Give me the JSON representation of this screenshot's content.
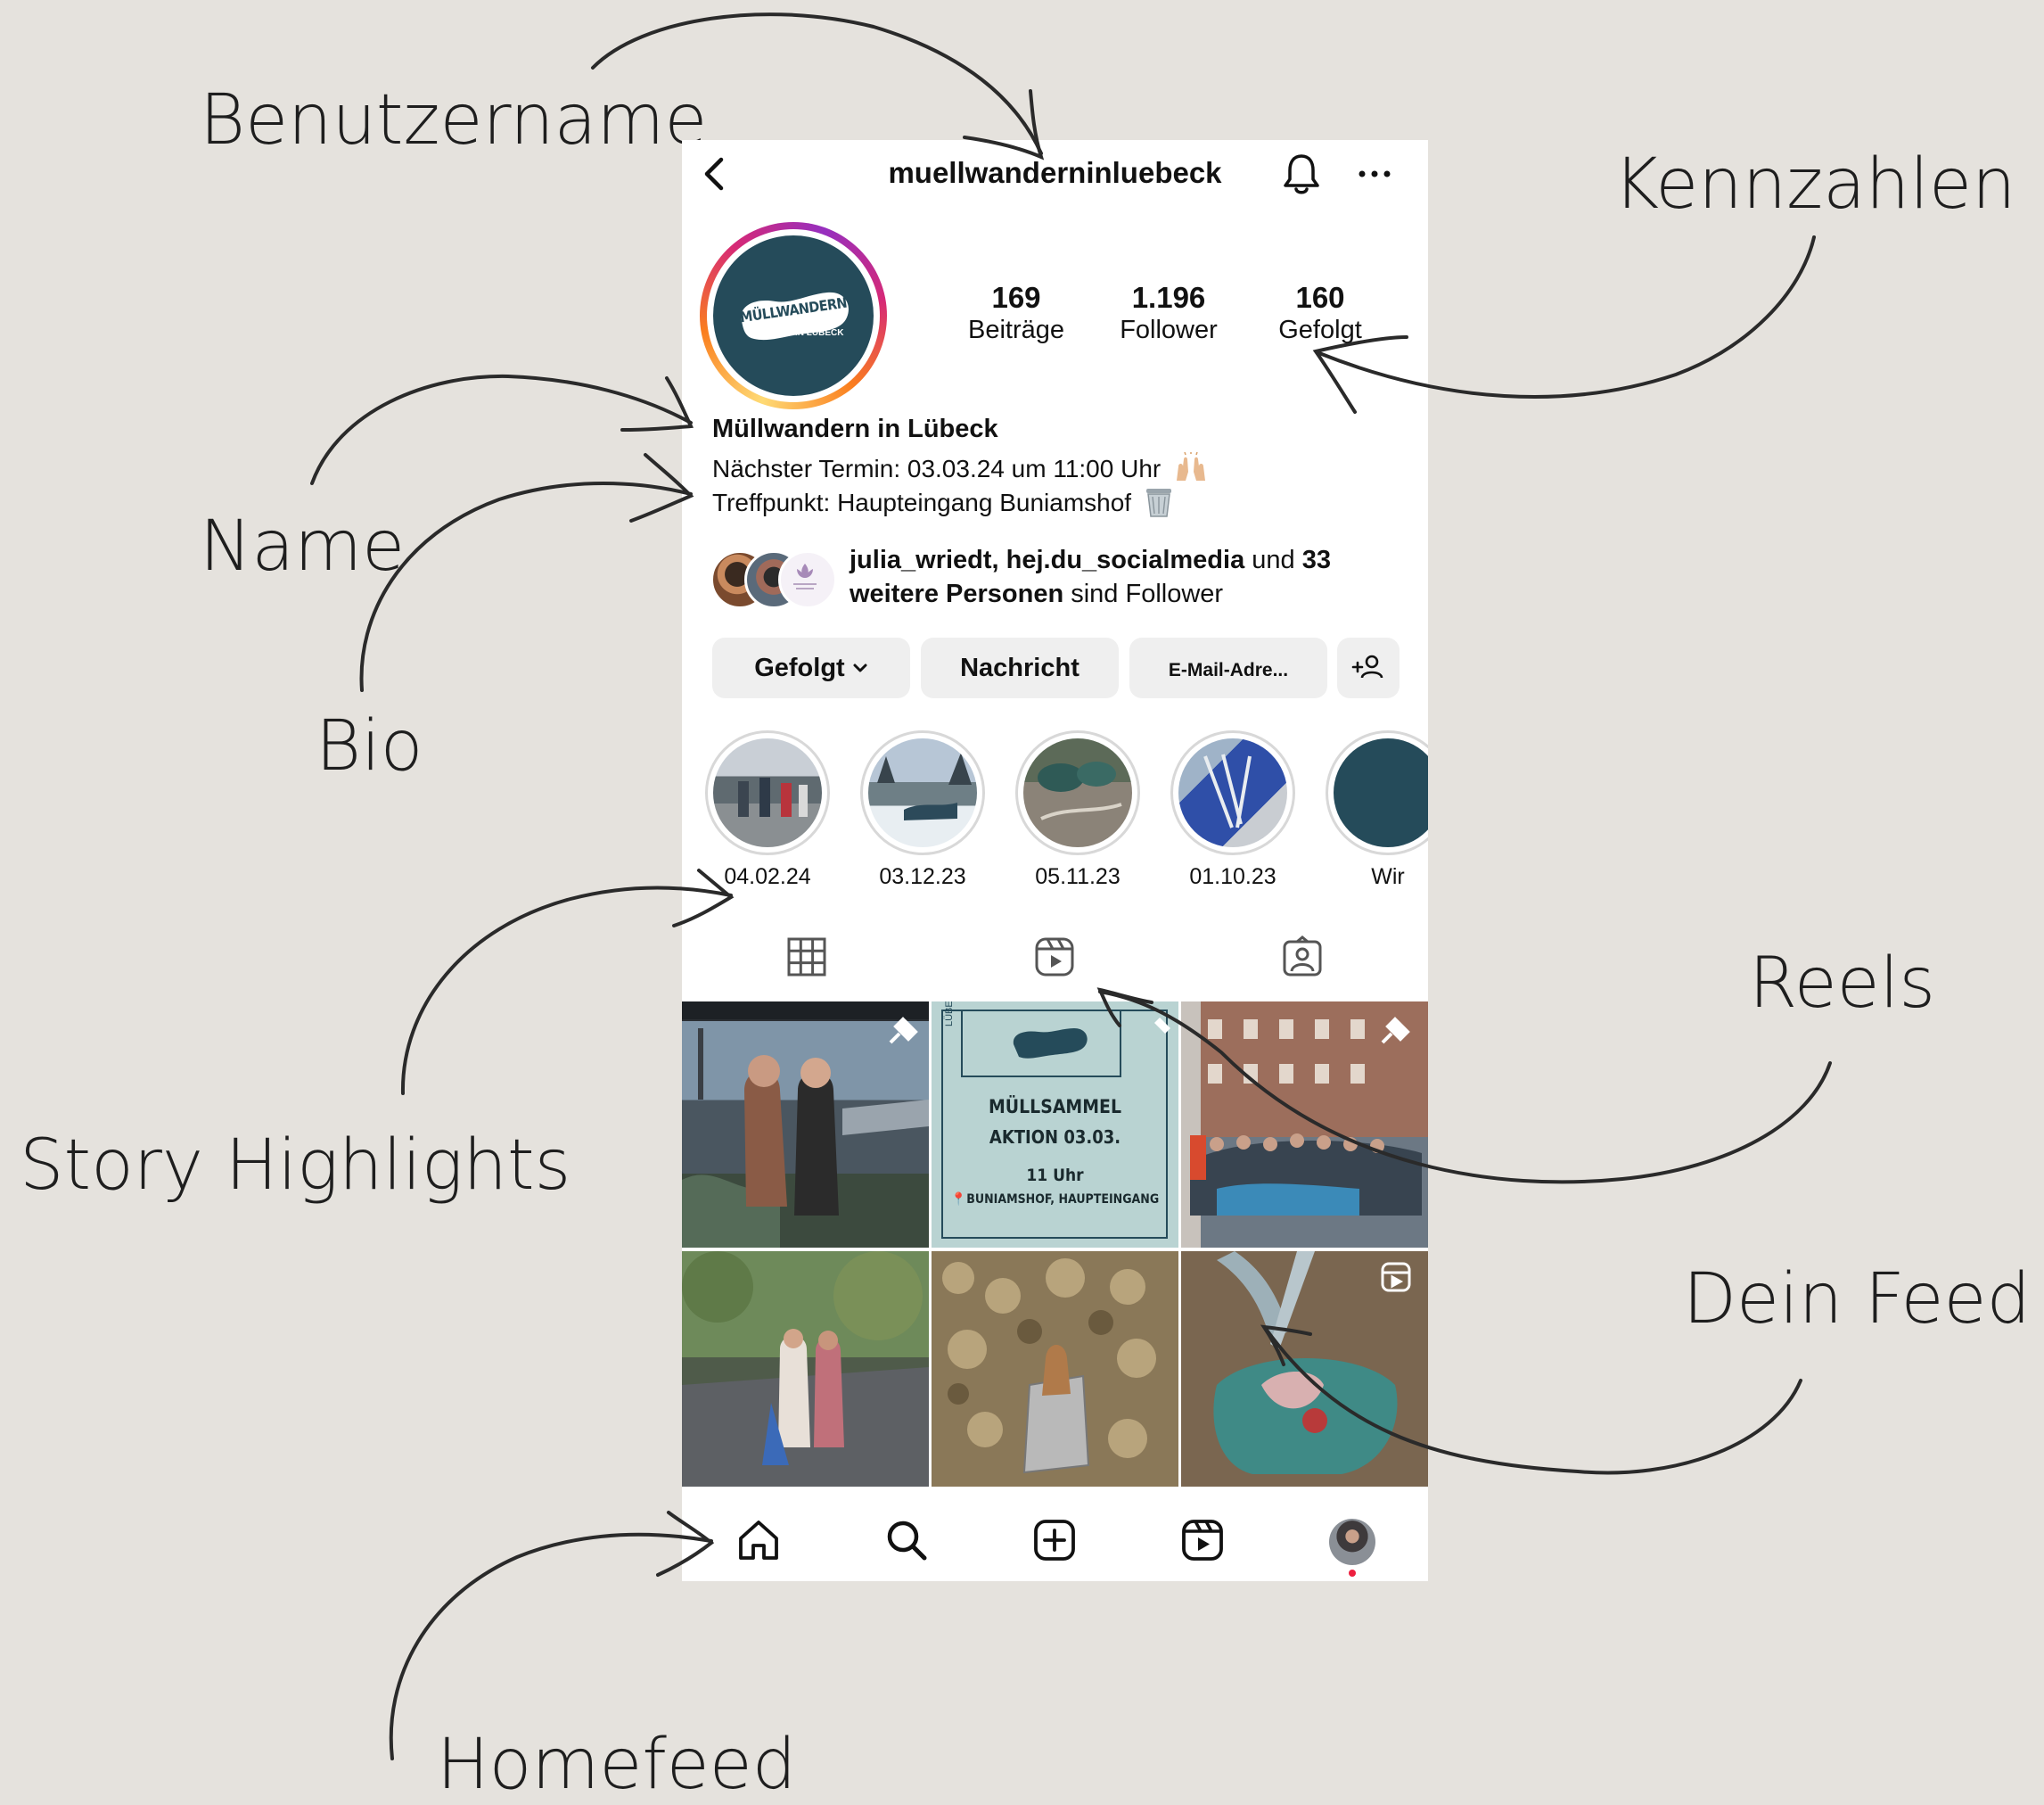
{
  "annotations": {
    "benutzername": "Benutzername",
    "kennzahlen": "Kennzahlen",
    "name": "Name",
    "bio": "Bio",
    "story_highlights": "Story Highlights",
    "reels": "Reels",
    "dein_feed": "Dein Feed",
    "homefeed": "Homefeed"
  },
  "profile": {
    "username": "muellwanderninluebeck",
    "logo_text": "MÜLLWANDERN",
    "logo_sub": "IN LÜBECK",
    "stats": [
      {
        "value": "169",
        "label": "Beiträge"
      },
      {
        "value": "1.196",
        "label": "Follower"
      },
      {
        "value": "160",
        "label": "Gefolgt"
      }
    ],
    "display_name": "Müllwandern in Lübeck",
    "bio_line1": "Nächster Termin: 03.03.24 um 11:00 Uhr",
    "bio_line2": "Treffpunkt: Haupteingang Buniamshof",
    "followed_by": {
      "names": "julia_wriedt, hej.du_socialmedia",
      "und": "und",
      "count": "33",
      "line2_bold": "weitere Personen",
      "line2_rest": "sind Follower"
    }
  },
  "buttons": {
    "following": "Gefolgt",
    "message": "Nachricht",
    "email": "E-Mail-Adre..."
  },
  "highlights": [
    {
      "label": "04.02.24"
    },
    {
      "label": "03.12.23"
    },
    {
      "label": "05.11.23"
    },
    {
      "label": "01.10.23"
    },
    {
      "label": "Wir"
    }
  ],
  "feed": {
    "poster": {
      "side_text": "LÜBECK",
      "title1": "MÜLLSAMMEL",
      "title2": "AKTION 03.03.",
      "time": "11 Uhr",
      "place": "BUNIAMSHOF, HAUPTEINGANG"
    }
  },
  "colors": {
    "background": "#e5e2dd",
    "brand_teal": "#254b5a",
    "poster_bg": "#b9d3d2",
    "notification_dot": "#ed1f3f"
  }
}
